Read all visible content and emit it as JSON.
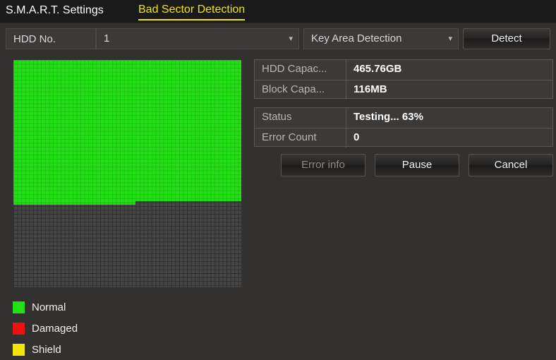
{
  "tabs": [
    {
      "label": "S.M.A.R.T. Settings",
      "active": false
    },
    {
      "label": "Bad Sector Detection",
      "active": true
    }
  ],
  "toolbar": {
    "hdd_label": "HDD No.",
    "hdd_value": "1",
    "hdd_chevron": "chevron-down-icon",
    "mode_value": "Key Area Detection",
    "mode_chevron": "chevron-down-icon",
    "detect_label": "Detect"
  },
  "info": {
    "capacity_rows": [
      {
        "label": "HDD Capac...",
        "value": "465.76GB"
      },
      {
        "label": "Block Capa...",
        "value": "116MB"
      }
    ],
    "status_rows": [
      {
        "label": "Status",
        "value": "Testing... 63%"
      },
      {
        "label": "Error Count",
        "value": "0"
      }
    ]
  },
  "actions": {
    "error_info_label": "Error info",
    "pause_label": "Pause",
    "cancel_label": "Cancel"
  },
  "legend": [
    {
      "label": "Normal",
      "color": "#22e015"
    },
    {
      "label": "Damaged",
      "color": "#ee1111"
    },
    {
      "label": "Shield",
      "color": "#f2e600"
    }
  ],
  "sector_map": {
    "progress_percent": 63,
    "columns": 58,
    "rows": 58,
    "tested_color": "#22e015",
    "untested_color": "#474646"
  },
  "colors": {
    "background": "#333130",
    "titlebar": "#1a1a1a",
    "accent": "#f2e600",
    "field": "#3c3a39"
  }
}
